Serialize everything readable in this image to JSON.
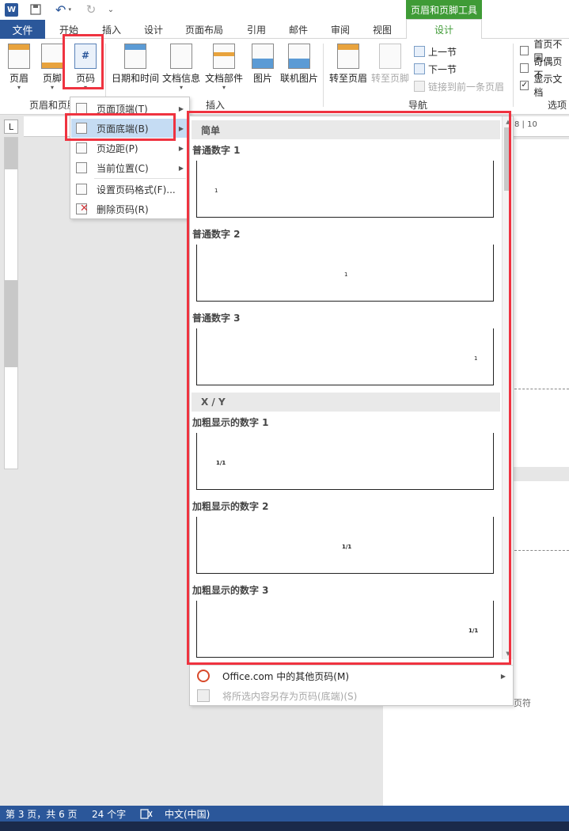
{
  "app": {
    "logo": "W"
  },
  "titlebar": {
    "contextual_group": "页眉和页脚工具",
    "icons": [
      "word-icon",
      "save-icon",
      "undo-icon",
      "redo-icon",
      "qa-more-icon"
    ]
  },
  "tabs": {
    "file": "文件",
    "items": [
      "开始",
      "插入",
      "设计",
      "页面布局",
      "引用",
      "邮件",
      "审阅",
      "视图"
    ],
    "active": "设计"
  },
  "ribbon": {
    "header_footer": {
      "header": "页眉",
      "footer": "页脚",
      "page_number": "页码",
      "group": "页眉和页脚"
    },
    "insert": {
      "datetime": "日期和时间",
      "docinfo": "文档信息",
      "parts": "文档部件",
      "picture": "图片",
      "online_picture": "联机图片",
      "group": "插入"
    },
    "navigation": {
      "goto_header": "转至页眉",
      "goto_footer": "转至页脚",
      "prev": "上一节",
      "next": "下一节",
      "link_prev": "链接到前一条页眉",
      "group": "导航"
    },
    "options": {
      "first_page": "首页不同",
      "odd_even": "奇偶页不",
      "show_doc": "显示文档",
      "group": "选项"
    }
  },
  "page_number_menu": {
    "items": [
      {
        "label": "页面顶端(T)",
        "submenu": true
      },
      {
        "label": "页面底端(B)",
        "submenu": true
      },
      {
        "label": "页边距(P)",
        "submenu": true
      },
      {
        "label": "当前位置(C)",
        "submenu": true
      },
      {
        "label": "设置页码格式(F)...",
        "submenu": false
      },
      {
        "label": "删除页码(R)",
        "submenu": false
      }
    ]
  },
  "gallery": {
    "sections": [
      {
        "header": "简单",
        "items": [
          {
            "title": "普通数字 1",
            "sample": "1",
            "align": "left"
          },
          {
            "title": "普通数字 2",
            "sample": "1",
            "align": "center"
          },
          {
            "title": "普通数字 3",
            "sample": "1",
            "align": "right"
          }
        ]
      },
      {
        "header": "X / Y",
        "items": [
          {
            "title": "加粗显示的数字 1",
            "sample": "1/1",
            "align": "left"
          },
          {
            "title": "加粗显示的数字 2",
            "sample": "1/1",
            "align": "center"
          },
          {
            "title": "加粗显示的数字 3",
            "sample": "1/1",
            "align": "right"
          }
        ]
      }
    ],
    "more_online": "Office.com 中的其他页码(M)",
    "save_selection": "将所选内容另存为页码(底端)(S)"
  },
  "document": {
    "ruler_numbers": "8 | 10",
    "footer_mark": "页符"
  },
  "statusbar": {
    "page": "第 3 页，共 6 页",
    "words": "24 个字",
    "language": "中文(中国)"
  },
  "highlight_color": "#ef3340"
}
